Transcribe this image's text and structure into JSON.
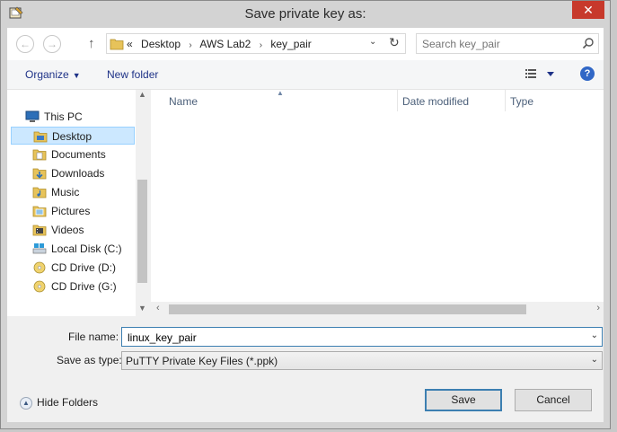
{
  "window": {
    "title": "Save private key as:",
    "close_glyph": "✕"
  },
  "nav_buttons": {
    "back": "←",
    "forward": "→",
    "up": "↑"
  },
  "address": {
    "prefix": "«",
    "crumbs": [
      "Desktop",
      "AWS Lab2",
      "key_pair"
    ],
    "separator": "›",
    "dropdown": "⌄",
    "refresh": "↻"
  },
  "search": {
    "placeholder": "Search key_pair"
  },
  "toolbar": {
    "organize_label": "Organize",
    "new_folder_label": "New folder",
    "caret": "▼"
  },
  "nav_pane": {
    "items": [
      {
        "label": "This PC",
        "icon": "computer-icon"
      },
      {
        "label": "Desktop",
        "icon": "folder-icon",
        "selected": true
      },
      {
        "label": "Documents",
        "icon": "documents-folder-icon"
      },
      {
        "label": "Downloads",
        "icon": "downloads-folder-icon"
      },
      {
        "label": "Music",
        "icon": "music-folder-icon"
      },
      {
        "label": "Pictures",
        "icon": "pictures-folder-icon"
      },
      {
        "label": "Videos",
        "icon": "videos-folder-icon"
      },
      {
        "label": "Local Disk (C:)",
        "icon": "drive-icon"
      },
      {
        "label": "CD Drive (D:)",
        "icon": "cd-drive-icon"
      },
      {
        "label": "CD Drive (G:)",
        "icon": "cd-drive-icon"
      }
    ]
  },
  "file_list": {
    "columns": [
      "Name",
      "Date modified",
      "Type"
    ]
  },
  "form": {
    "file_name_label": "File name:",
    "file_name_value": "linux_key_pair",
    "save_type_label": "Save as type:",
    "save_type_value": "PuTTY Private Key Files (*.ppk)"
  },
  "footer": {
    "hide_folders_label": "Hide Folders",
    "save_label": "Save",
    "cancel_label": "Cancel"
  },
  "colors": {
    "close_button": "#c7392b",
    "selection": "#cce8ff",
    "accent": "#3c7fb1",
    "link_blue": "#1e3287"
  }
}
